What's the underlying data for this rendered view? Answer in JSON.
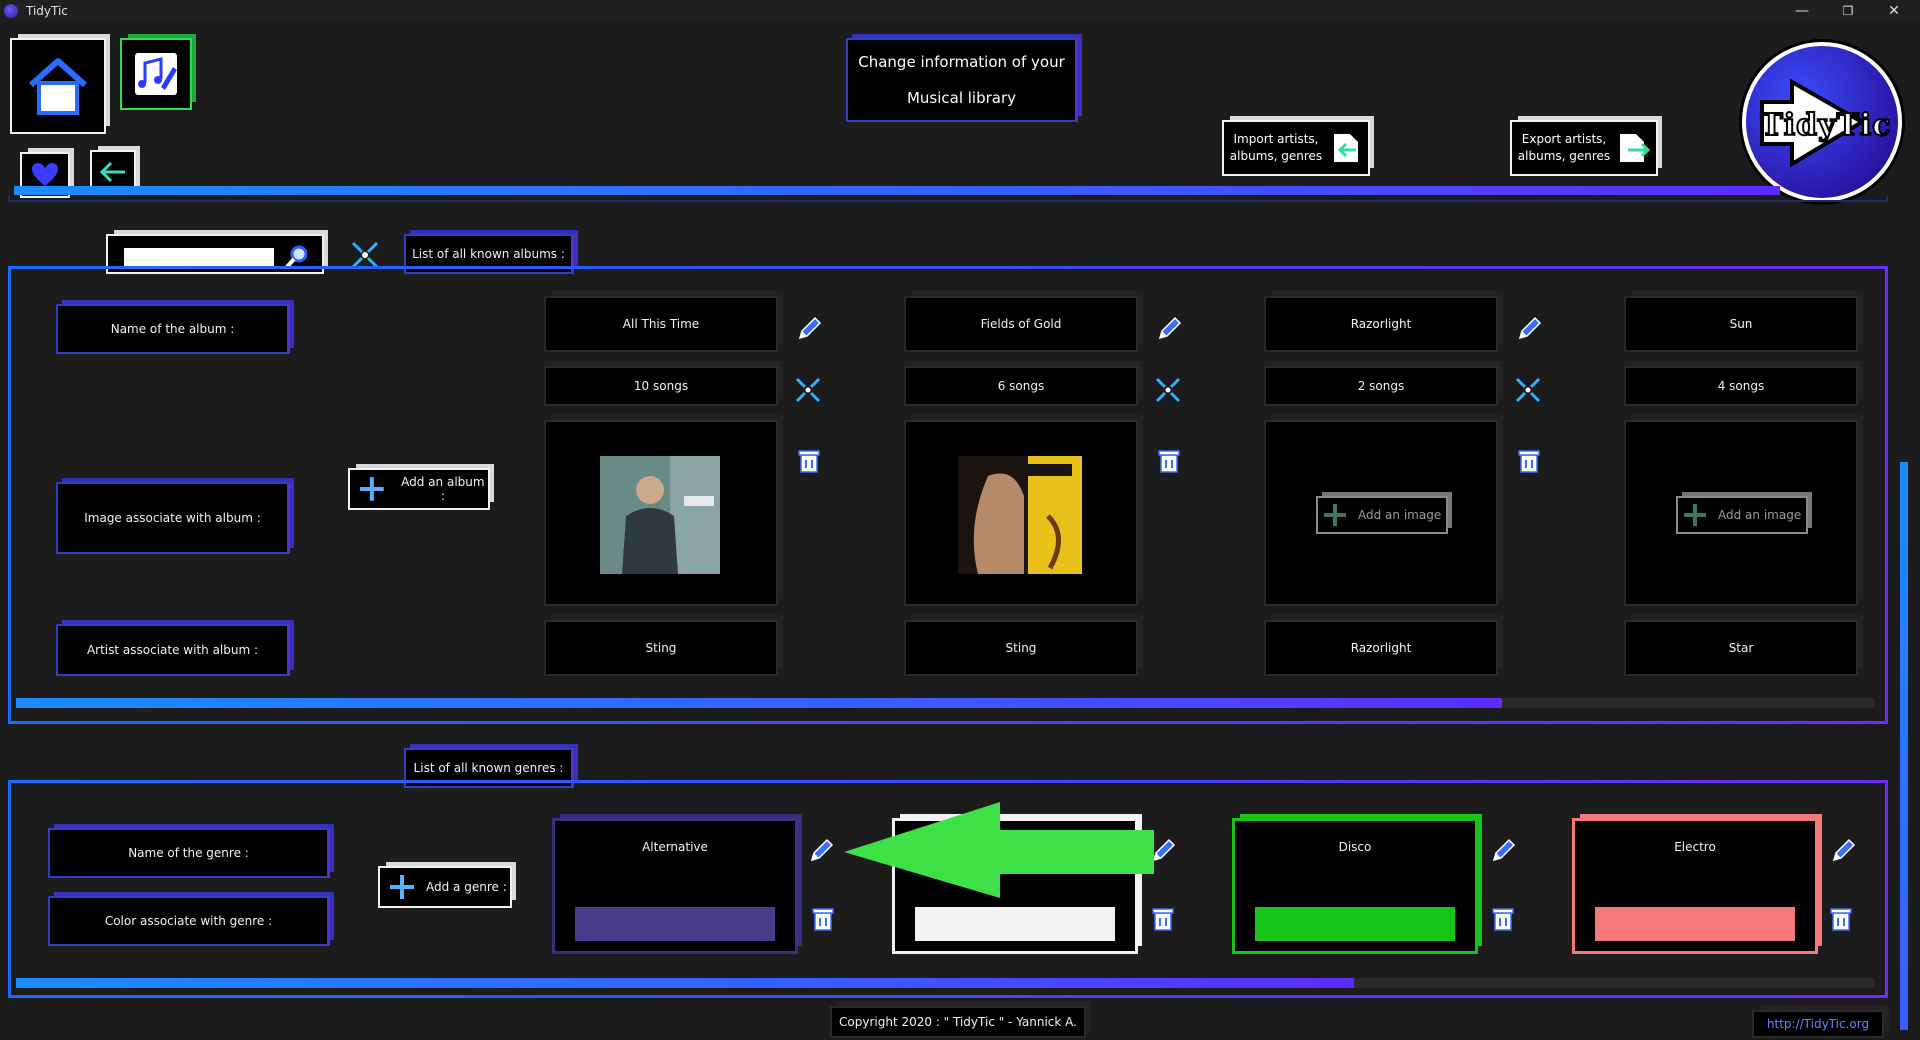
{
  "window": {
    "title": "TidyTic",
    "controls": {
      "minimize": "—",
      "restore": "❐",
      "close": "✕"
    }
  },
  "header": {
    "title_line1": "Change information of your",
    "title_line2": "Musical library",
    "import_line1": "Import artists,",
    "import_line2": "albums, genres",
    "export_line1": "Export artists,",
    "export_line2": "albums, genres",
    "logo_text": "TidyTic"
  },
  "search": {
    "value": "",
    "placeholder": ""
  },
  "albums_section": {
    "heading": "List of all known albums :",
    "label_name": "Name of the album :",
    "label_image": "Image associate with album :",
    "label_artist": "Artist associate with album :",
    "add_button": "Add an album :",
    "add_image_label": "Add an image",
    "items": [
      {
        "name": "All This Time",
        "songs": "10 songs",
        "artist": "Sting",
        "has_image": true
      },
      {
        "name": "Fields of Gold",
        "songs": "6 songs",
        "artist": "Sting",
        "has_image": true
      },
      {
        "name": "Razorlight",
        "songs": "2 songs",
        "artist": "Razorlight",
        "has_image": false
      },
      {
        "name": "Sun",
        "songs": "4 songs",
        "artist": "Star",
        "has_image": false
      }
    ],
    "scroll_fraction": 0.8
  },
  "genres_section": {
    "heading": "List of all known genres :",
    "label_name": "Name of the genre :",
    "label_color": "Color associate with genre :",
    "add_button": "Add a genre :",
    "items": [
      {
        "name": "Alternative",
        "color": "#4a3c8c",
        "border": "#3a2f80"
      },
      {
        "name": "",
        "color": "#f2f2f2",
        "border": "#f2f2f2"
      },
      {
        "name": "Disco",
        "color": "#16c41a",
        "border": "#16c41a"
      },
      {
        "name": "Electro",
        "color": "#f57a77",
        "border": "#f57a77"
      }
    ],
    "scroll_fraction": 0.72
  },
  "footer": {
    "copyright": "Copyright 2020 : \" TidyTic \" - Yannick A.",
    "link": "http://TidyTic.org"
  },
  "colors": {
    "accent_blue": "#1b8cff",
    "accent_purple": "#5b2cff",
    "arrow_green": "#3de046"
  }
}
